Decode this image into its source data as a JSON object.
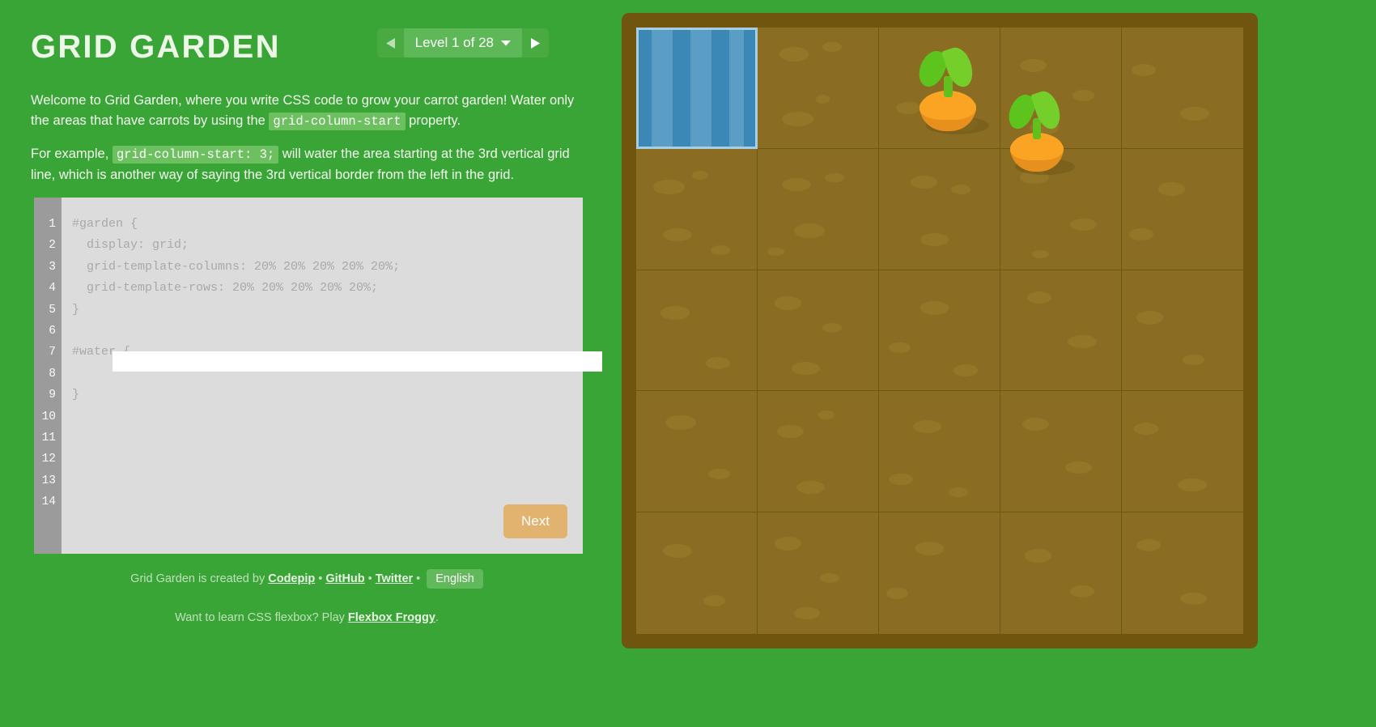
{
  "header": {
    "title": "GRID GARDEN",
    "level_selector": {
      "prev_icon": "triangle-left-icon",
      "next_icon": "triangle-right-icon",
      "dropdown_icon": "chevron-down-icon",
      "label": "Level 1 of 28",
      "current_level": 1,
      "total_levels": 28
    }
  },
  "instructions": {
    "p1_before": "Welcome to Grid Garden, where you write CSS code to grow your carrot garden! Water only the areas that have carrots by using the ",
    "p1_code": "grid-column-start",
    "p1_after": " property.",
    "p2_before": "For example, ",
    "p2_code": "grid-column-start: 3;",
    "p2_after": " will water the area starting at the 3rd vertical grid line, which is another way of saying the 3rd vertical border from the left in the grid."
  },
  "editor": {
    "line_numbers": [
      "1",
      "2",
      "3",
      "4",
      "5",
      "6",
      "7",
      "8",
      "9",
      "10",
      "11",
      "12",
      "13",
      "14"
    ],
    "code_lines": [
      "#garden {",
      "  display: grid;",
      "  grid-template-columns: 20% 20% 20% 20% 20%;",
      "  grid-template-rows: 20% 20% 20% 20% 20%;",
      "}",
      "",
      "#water {"
    ],
    "code_lines_after": [
      "}"
    ],
    "input_value": "",
    "input_placeholder": "",
    "next_label": "Next"
  },
  "footer": {
    "credit_text": "Grid Garden is created by",
    "link_codepip": "Codepip",
    "link_github": "GitHub",
    "link_twitter": "Twitter",
    "separator": "•",
    "language_label": "English",
    "flexbox_before": "Want to learn CSS flexbox? Play ",
    "flexbox_link": "Flexbox Froggy",
    "flexbox_after": "."
  },
  "garden": {
    "columns": 5,
    "rows": 5,
    "water": {
      "column_start": 1,
      "row_start": 1,
      "column_span": 1,
      "row_span": 1
    },
    "carrots": [
      {
        "column": 3,
        "row": 1
      },
      {
        "column": 4,
        "row": 1
      }
    ]
  },
  "colors": {
    "background_green": "#3aa537",
    "soil": "#8a6d22",
    "soil_frame": "#70550f",
    "grid_line": "#6e5618",
    "water_blue": "#3b87b5",
    "water_wave": "#5a9ec6",
    "water_border": "#a9cde2",
    "carrot_orange": "#fba424",
    "carrot_orange_dark": "#e8901e",
    "leaf_green": "#5cc41c",
    "editor_background": "#dcdcdc",
    "gutter_gray": "#9b9b9b",
    "code_text_gray": "#a9a9a9",
    "next_button": "#e2b36e",
    "inline_code_bg": "#6cc05f"
  }
}
